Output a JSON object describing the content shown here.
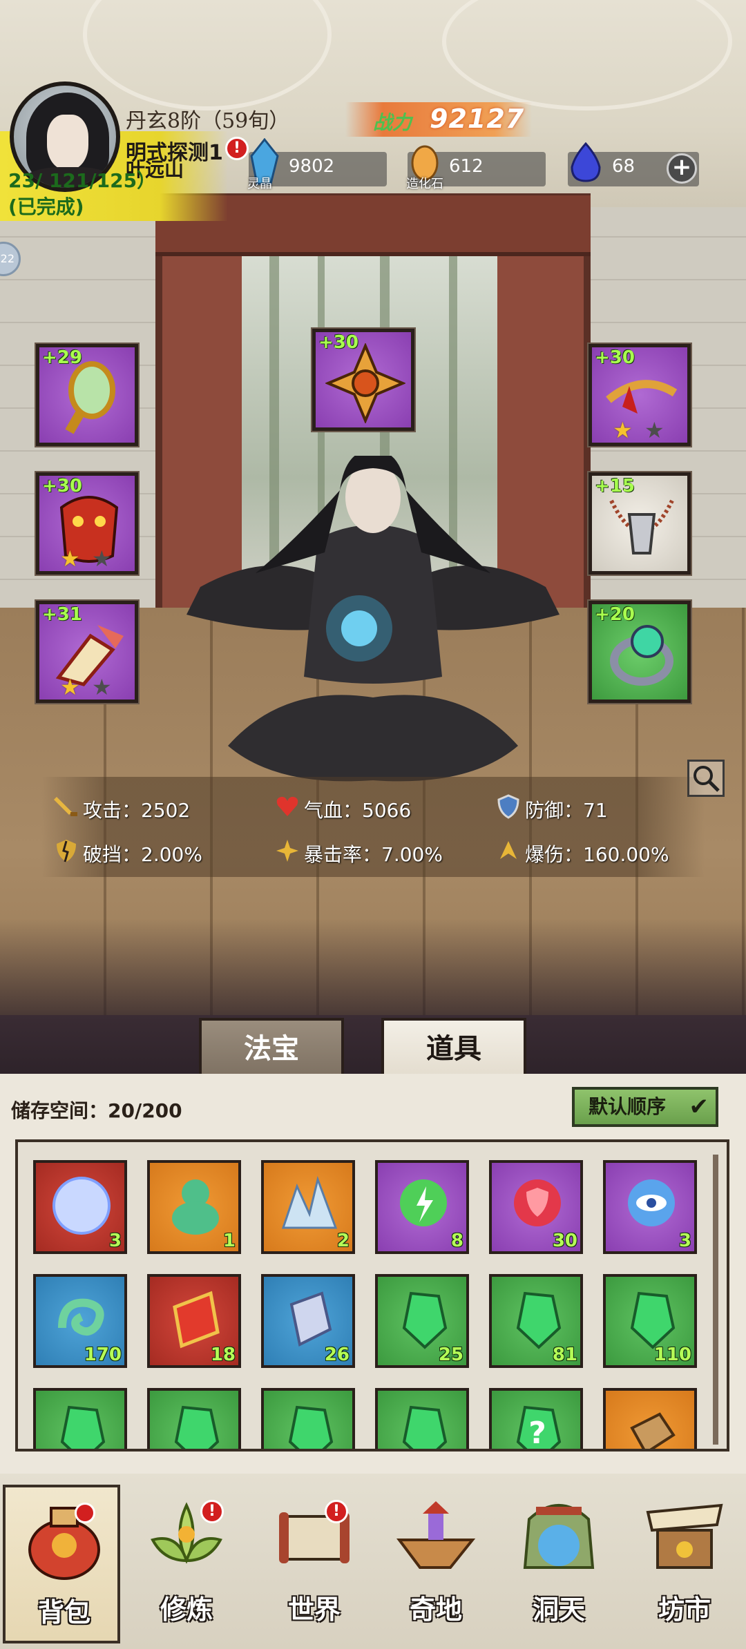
{
  "header": {
    "realm": "丹玄8阶（59旬）",
    "quest_title": "明式探测1",
    "player_name": "叶远山",
    "quest_progress": "23/ 121/125）",
    "quest_status": "(已完成)",
    "side_bubble": "22",
    "power_label": "战力",
    "power_value": "92127",
    "alert": "!"
  },
  "resources": [
    {
      "name": "灵晶",
      "value": "9802",
      "icon": "blue-crystal-icon"
    },
    {
      "name": "造化石",
      "value": "612",
      "icon": "golden-stone-icon"
    },
    {
      "name": "",
      "value": "68",
      "icon": "blue-flame-icon"
    }
  ],
  "equipment": {
    "left": [
      {
        "level": "+29",
        "icon": "mirror-icon",
        "rarity": "purple",
        "stars": 0
      },
      {
        "level": "+30",
        "icon": "demon-armor-icon",
        "rarity": "purple",
        "stars": 2,
        "gold_stars": 1
      },
      {
        "level": "+31",
        "icon": "winged-boots-icon",
        "rarity": "purple",
        "stars": 2,
        "gold_stars": 1
      }
    ],
    "center": {
      "level": "+30",
      "icon": "compass-amulet-icon",
      "rarity": "purple"
    },
    "right": [
      {
        "level": "+30",
        "icon": "crown-ring-icon",
        "rarity": "purple",
        "stars": 2,
        "gold_stars": 1
      },
      {
        "level": "+15",
        "icon": "bead-necklace-icon",
        "rarity": "white",
        "stars": 0
      },
      {
        "level": "+20",
        "icon": "jade-ring-icon",
        "rarity": "green",
        "stars": 0
      }
    ]
  },
  "stats": {
    "attack": "攻击：2502",
    "hp": "气血：5066",
    "defense": "防御：71",
    "penetration": "破挡：2.00%",
    "crit_rate": "暴击率：7.00%",
    "crit_damage": "爆伤：160.00%"
  },
  "tabs": {
    "treasure": "法宝",
    "items": "道具"
  },
  "inventory": {
    "storage_label": "储存空间：20/200",
    "sort_label": "默认顺序",
    "items": [
      {
        "color": "red",
        "icon": "rainbow-orb-icon",
        "count": "3"
      },
      {
        "color": "orange",
        "icon": "jade-gourd-icon",
        "count": "1"
      },
      {
        "color": "orange",
        "icon": "ice-crystal-icon",
        "count": "2"
      },
      {
        "color": "purple",
        "icon": "lightning-orb-icon",
        "count": "8"
      },
      {
        "color": "purple",
        "icon": "shield-orb-icon",
        "count": "30"
      },
      {
        "color": "purple",
        "icon": "eye-orb-icon",
        "count": "3"
      },
      {
        "color": "blue",
        "icon": "spiral-jade-icon",
        "count": "170"
      },
      {
        "color": "red",
        "icon": "red-talisman-icon",
        "count": "18"
      },
      {
        "color": "blue",
        "icon": "silver-talisman-icon",
        "count": "26"
      },
      {
        "color": "green",
        "icon": "green-gem-icon",
        "count": "25"
      },
      {
        "color": "green",
        "icon": "green-gem-icon",
        "count": "81"
      },
      {
        "color": "green",
        "icon": "green-gem-icon",
        "count": "110"
      },
      {
        "color": "green",
        "icon": "green-gem-icon",
        "count": ""
      },
      {
        "color": "green",
        "icon": "green-gem-icon",
        "count": ""
      },
      {
        "color": "green",
        "icon": "green-gem-icon",
        "count": ""
      },
      {
        "color": "green",
        "icon": "green-gem-icon",
        "count": ""
      },
      {
        "color": "green",
        "icon": "mystery-gem-icon",
        "count": "",
        "glyph": "?"
      },
      {
        "color": "orange",
        "icon": "scroll-fragment-icon",
        "count": ""
      }
    ]
  },
  "nav": [
    {
      "label": "背包",
      "icon": "backpack-icon",
      "active": true
    },
    {
      "label": "修炼",
      "icon": "lotus-icon",
      "alert": true
    },
    {
      "label": "世界",
      "icon": "map-scroll-icon",
      "alert": true
    },
    {
      "label": "奇地",
      "icon": "floating-island-icon"
    },
    {
      "label": "洞天",
      "icon": "portal-icon"
    },
    {
      "label": "坊市",
      "icon": "market-stall-icon"
    }
  ],
  "colors": {
    "accent_green": "#a9ff4f",
    "alert_red": "#d21f1f",
    "power_orange": "#e87a3c"
  }
}
